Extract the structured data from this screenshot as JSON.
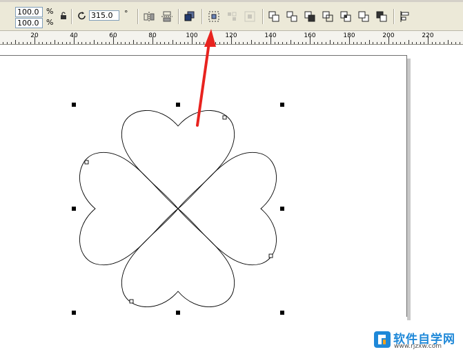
{
  "toolbar": {
    "scale_x_value": "100.0",
    "scale_y_value": "100.0",
    "percent_unit": "%",
    "rotation_value": "315.0",
    "degree_unit": "°",
    "icons": [
      "lock-ratio-icon",
      "rotate-icon",
      "mirror-horizontal-icon",
      "mirror-vertical-icon",
      "arrange-to-front-icon",
      "group-icon",
      "ungroup-icon",
      "ungroup-all-icon",
      "combine-icon",
      "break-apart-icon",
      "weld-icon",
      "trim-icon",
      "intersect-icon",
      "simplify-icon",
      "front-minus-back-icon",
      "align-distribute-icon"
    ]
  },
  "ruler": {
    "labels": [
      "20",
      "40",
      "60",
      "80",
      "100",
      "120",
      "140",
      "160",
      "180",
      "200",
      "220"
    ]
  },
  "drawing": {
    "shape": "four-leaf-clover",
    "stroke_color": "#000000",
    "annotation_arrow_color": "#e8231f"
  },
  "watermark": {
    "brand": "软件自学网",
    "url": "www.rjzxw.com"
  }
}
